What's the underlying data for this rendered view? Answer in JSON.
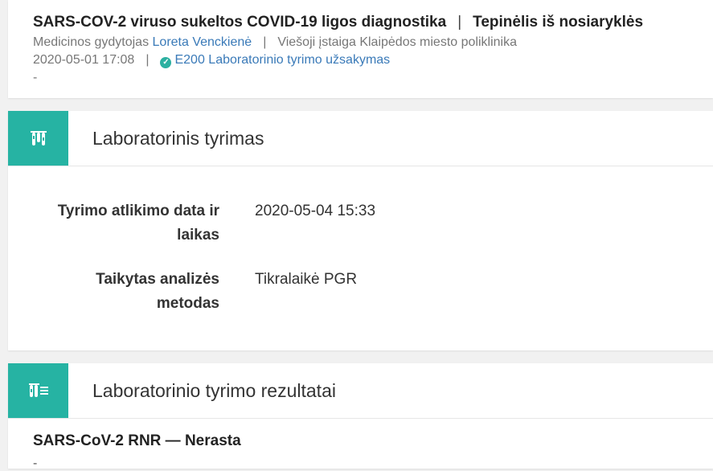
{
  "record": {
    "title": "SARS-COV-2 viruso sukeltos COVID-19 ligos diagnostika",
    "title_separator": "|",
    "specimen": "Tepinėlis iš nosiaryklės",
    "doctor_prefix": "Medicinos gydytojas",
    "doctor_name": "Loreta Venckienė",
    "meta_separator": "|",
    "institution": "Viešoji įstaiga Klaipėdos miesto poliklinika",
    "datetime": "2020-05-01 17:08",
    "order_status": "E200 Laboratorinio tyrimo užsakymas",
    "note": "-"
  },
  "lab_test": {
    "title": "Laboratorinis tyrimas",
    "fields": [
      {
        "label": "Tyrimo atlikimo data ir laikas",
        "value": "2020-05-04 15:33"
      },
      {
        "label": "Taikytas analizės metodas",
        "value": "Tikralaikė PGR"
      }
    ]
  },
  "results": {
    "title": "Laboratorinio tyrimo rezultatai",
    "result_line": "SARS-CoV-2 RNR — Nerasta",
    "note": "-"
  },
  "colors": {
    "accent": "#26b3a3",
    "link": "#3a7ab8",
    "page_bg": "#f1f1f1"
  },
  "icons": {
    "lab_test": "test-tubes-icon",
    "results": "test-tubes-list-icon",
    "status": "check-circle-icon"
  }
}
